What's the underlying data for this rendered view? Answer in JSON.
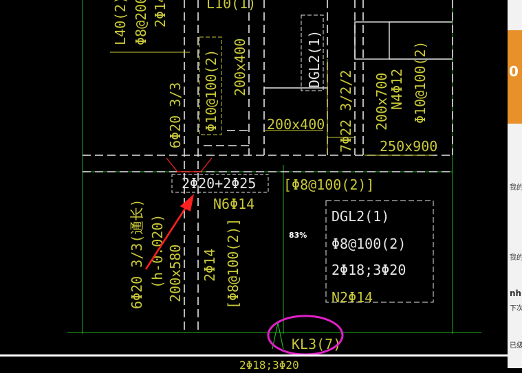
{
  "drawing": {
    "labels": {
      "l40": "L40(2)",
      "l40_stir": "Φ8@200",
      "l40_bars": "2Φ14",
      "top_partial": "L10(1)",
      "stir_left": "Φ10@100(2)",
      "sec_200x400_v": "200x400",
      "dgl2_v": "DGL2(1)",
      "sec_200x400_h": "200x400",
      "bars_6_20": "6Φ20 3/3",
      "bars_7_22": "7Φ22 3/2/2",
      "sec_200x700": "200x700",
      "n4": "N4Φ12",
      "stir_right": "Φ10@100(2)",
      "sec_250x900": "250x900",
      "bottom_bars": "2Φ20+2Φ25",
      "stir_mid": "[Φ8@100(2)]",
      "n6": "N6Φ14",
      "bars_left": "6Φ20 3/3(通长)",
      "offset": "(h-0.020)",
      "sec_200x580": "200x580",
      "bars_2_14": "2Φ14",
      "stir_bracket": "[Φ8@100(2)]",
      "dgl2_name": "DGL2(1)",
      "dgl2_stir": "Φ8@100(2)",
      "dgl2_bars": "2Φ18;3Φ20",
      "dgl2_n2": "N2Φ14",
      "kl3": "KL3(7)",
      "bottom_cut": "2Φ18;3Φ20"
    },
    "zoom": "83%"
  },
  "side_panel": {
    "big_text": "0",
    "text_1": "我的",
    "text_2": "我的",
    "text_3": "nh",
    "text_4": "下次",
    "text_5": "已级"
  },
  "colors": {
    "background": "#000000",
    "cad_yellow": "#c9c93a",
    "cad_white": "#e6e6e6",
    "grid_green": "#1fb41f",
    "arrow_red": "#ff2020",
    "circle_magenta": "#e020c8",
    "accent_orange": "#e8912a"
  }
}
